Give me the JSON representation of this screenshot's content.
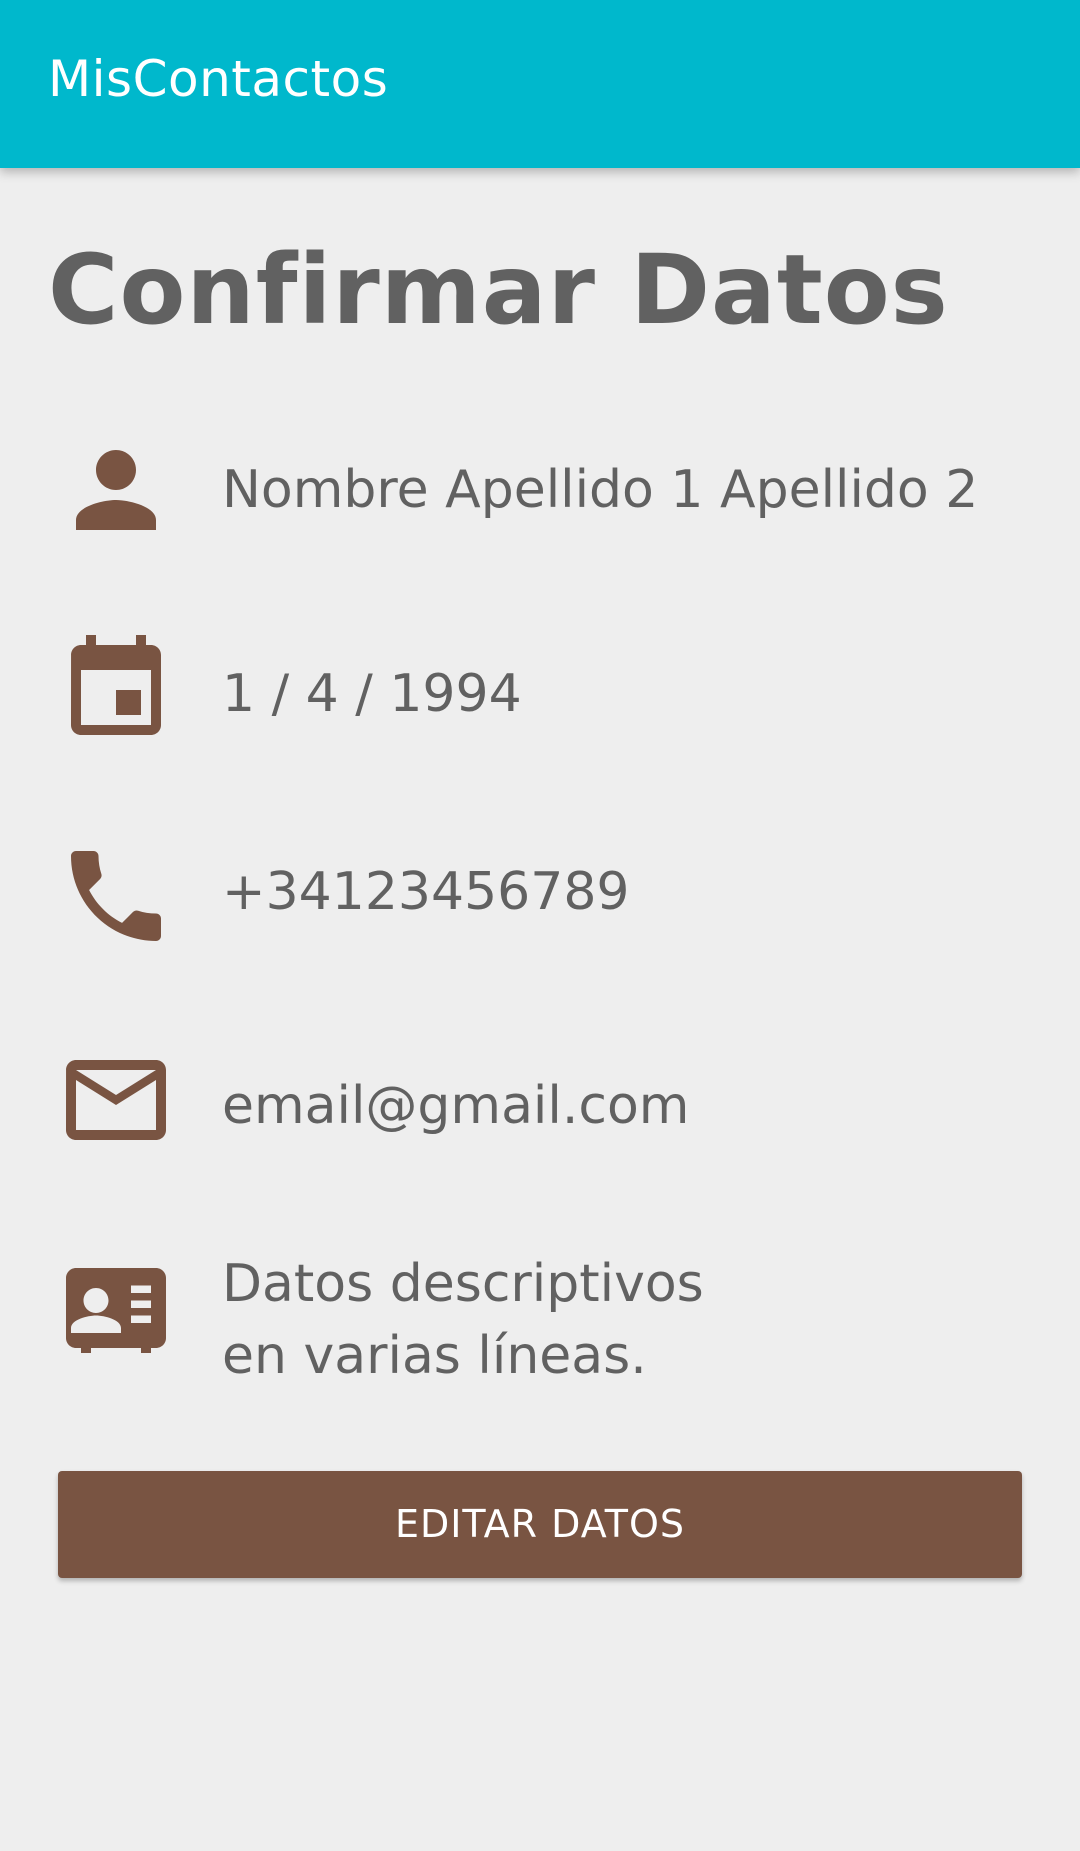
{
  "app": {
    "title": "MisContactos",
    "accent_color": "#00b8cc",
    "icon_color": "#795442"
  },
  "page": {
    "title": "Confirmar Datos"
  },
  "contact": {
    "name": {
      "icon": "person-icon",
      "value": "Nombre Apellido 1 Apellido 2"
    },
    "birthdate": {
      "icon": "calendar-icon",
      "value": "1 / 4 / 1994"
    },
    "phone": {
      "icon": "phone-icon",
      "value": "+34123456789"
    },
    "email": {
      "icon": "email-icon",
      "value": "email@gmail.com"
    },
    "description": {
      "icon": "contact-card-icon",
      "value": "Datos descriptivos\nen varias líneas."
    }
  },
  "actions": {
    "edit_label": "EDITAR DATOS"
  }
}
